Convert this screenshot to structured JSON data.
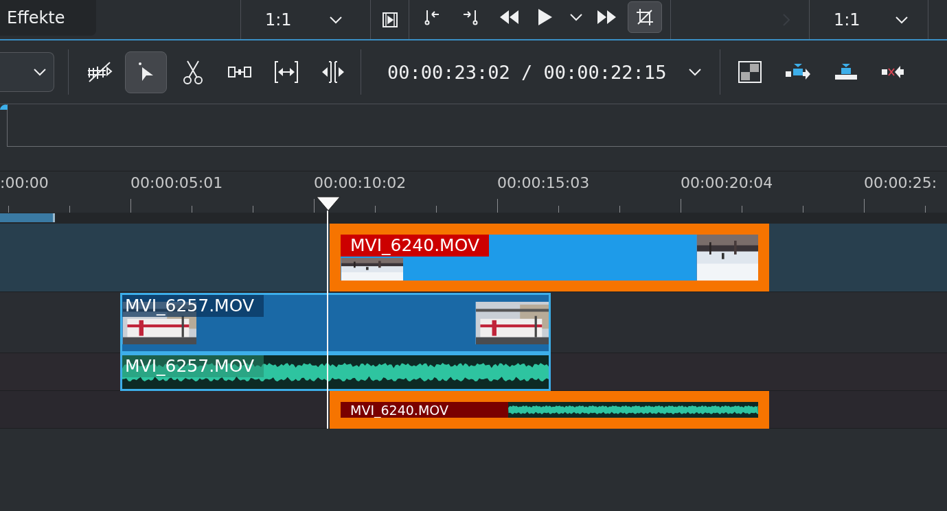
{
  "panel_tab": {
    "label": "Effekte"
  },
  "clip_monitor": {
    "zoom": "1:1"
  },
  "transport": {
    "crop_on": true
  },
  "project_monitor": {
    "zoom": "1:1"
  },
  "timeline_toolbar": {
    "tools": [
      {
        "kind": "ripple",
        "selected": false
      },
      {
        "kind": "select",
        "selected": true
      },
      {
        "kind": "razor",
        "selected": false
      },
      {
        "kind": "spacer",
        "selected": false
      },
      {
        "kind": "slip",
        "selected": false
      },
      {
        "kind": "slide",
        "selected": false
      }
    ],
    "timecode": "00:00:23:02 / 00:00:22:15"
  },
  "ruler": {
    "labels": [
      ":00:00",
      "00:00:05:01",
      "00:00:10:02",
      "00:00:15:03",
      "00:00:20:04",
      "00:00:25:"
    ]
  },
  "tracks": [
    {
      "selected": true
    },
    {
      "selected": false
    },
    {
      "selected": false
    },
    {
      "selected": false
    }
  ],
  "clips": [
    {
      "kind": "video",
      "name": "MVI_6240.MOV",
      "selected": true
    },
    {
      "kind": "video",
      "name": "MVI_6257.MOV",
      "selected": false
    },
    {
      "kind": "audio",
      "name": "MVI_6257.MOV",
      "selected": false
    },
    {
      "kind": "audio",
      "name": "MVI_6240.MOV",
      "selected": true
    }
  ]
}
